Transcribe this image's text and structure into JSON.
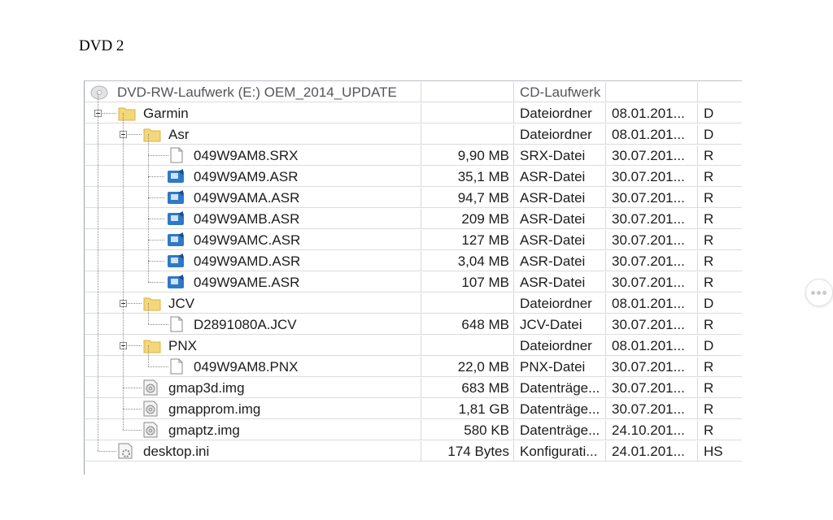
{
  "page": {
    "heading": "DVD 2"
  },
  "drive": {
    "name": "DVD-RW-Laufwerk (E:) OEM_2014_UPDATE",
    "type": "CD-Laufwerk",
    "icon": "dvd-drive-icon"
  },
  "rows": [
    {
      "name": "Garmin",
      "size": "",
      "type": "Dateiordner",
      "date": "08.01.201...",
      "attr": "D",
      "icon": "folder-icon"
    },
    {
      "name": "Asr",
      "size": "",
      "type": "Dateiordner",
      "date": "08.01.201...",
      "attr": "D",
      "icon": "folder-icon"
    },
    {
      "name": "049W9AM8.SRX",
      "size": "9,90 MB",
      "type": "SRX-Datei",
      "date": "30.07.201...",
      "attr": "R",
      "icon": "blank-file-icon"
    },
    {
      "name": "049W9AM9.ASR",
      "size": "35,1 MB",
      "type": "ASR-Datei",
      "date": "30.07.201...",
      "attr": "R",
      "icon": "asr-file-icon"
    },
    {
      "name": "049W9AMA.ASR",
      "size": "94,7 MB",
      "type": "ASR-Datei",
      "date": "30.07.201...",
      "attr": "R",
      "icon": "asr-file-icon"
    },
    {
      "name": "049W9AMB.ASR",
      "size": "209 MB",
      "type": "ASR-Datei",
      "date": "30.07.201...",
      "attr": "R",
      "icon": "asr-file-icon"
    },
    {
      "name": "049W9AMC.ASR",
      "size": "127 MB",
      "type": "ASR-Datei",
      "date": "30.07.201...",
      "attr": "R",
      "icon": "asr-file-icon"
    },
    {
      "name": "049W9AMD.ASR",
      "size": "3,04 MB",
      "type": "ASR-Datei",
      "date": "30.07.201...",
      "attr": "R",
      "icon": "asr-file-icon"
    },
    {
      "name": "049W9AME.ASR",
      "size": "107 MB",
      "type": "ASR-Datei",
      "date": "30.07.201...",
      "attr": "R",
      "icon": "asr-file-icon"
    },
    {
      "name": "JCV",
      "size": "",
      "type": "Dateiordner",
      "date": "08.01.201...",
      "attr": "D",
      "icon": "folder-icon"
    },
    {
      "name": "D2891080A.JCV",
      "size": "648 MB",
      "type": "JCV-Datei",
      "date": "30.07.201...",
      "attr": "R",
      "icon": "blank-file-icon"
    },
    {
      "name": "PNX",
      "size": "",
      "type": "Dateiordner",
      "date": "08.01.201...",
      "attr": "D",
      "icon": "folder-icon"
    },
    {
      "name": "049W9AM8.PNX",
      "size": "22,0 MB",
      "type": "PNX-Datei",
      "date": "30.07.201...",
      "attr": "R",
      "icon": "blank-file-icon"
    },
    {
      "name": "gmap3d.img",
      "size": "683 MB",
      "type": "Datenträge...",
      "date": "30.07.201...",
      "attr": "R",
      "icon": "disc-image-file-icon"
    },
    {
      "name": "gmapprom.img",
      "size": "1,81 GB",
      "type": "Datenträge...",
      "date": "30.07.201...",
      "attr": "R",
      "icon": "disc-image-file-icon"
    },
    {
      "name": "gmaptz.img",
      "size": "580 KB",
      "type": "Datenträge...",
      "date": "24.10.201...",
      "attr": "R",
      "icon": "disc-image-file-icon"
    },
    {
      "name": "desktop.ini",
      "size": "174 Bytes",
      "type": "Konfigurati...",
      "date": "24.01.201...",
      "attr": "HS",
      "icon": "settings-file-icon"
    }
  ],
  "colors": {
    "folder": "#f4d779",
    "asr_icon": "#2f78c7",
    "tree_line": "#8a8a8a"
  }
}
